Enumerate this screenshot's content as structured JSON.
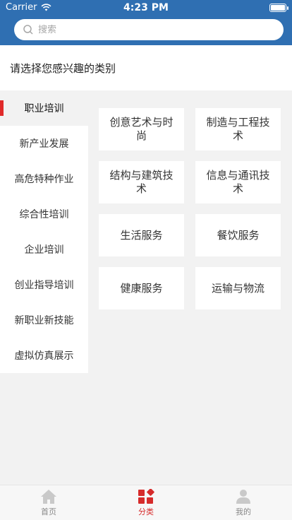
{
  "status_bar": {
    "carrier": "Carrier",
    "time": "4:23 PM"
  },
  "search": {
    "placeholder": "搜索"
  },
  "prompt": "请选择您感兴趣的类别",
  "sidebar": {
    "items": [
      {
        "label": "职业培训",
        "active": true
      },
      {
        "label": "新产业发展"
      },
      {
        "label": "高危特种作业"
      },
      {
        "label": "综合性培训"
      },
      {
        "label": "企业培训"
      },
      {
        "label": "创业指导培训"
      },
      {
        "label": "新职业新技能"
      },
      {
        "label": "虚拟仿真展示"
      }
    ]
  },
  "categories": [
    {
      "label": "创意艺术与时尚"
    },
    {
      "label": "制造与工程技术"
    },
    {
      "label": "结构与建筑技术"
    },
    {
      "label": "信息与通讯技术"
    },
    {
      "label": "生活服务"
    },
    {
      "label": "餐饮服务"
    },
    {
      "label": "健康服务"
    },
    {
      "label": "运输与物流"
    }
  ],
  "tabbar": {
    "tabs": [
      {
        "label": "首页",
        "icon": "home-icon"
      },
      {
        "label": "分类",
        "icon": "category-icon",
        "active": true
      },
      {
        "label": "我的",
        "icon": "user-icon"
      }
    ]
  },
  "colors": {
    "header": "#2f6fb2",
    "accent": "#e02a2a",
    "tab_active": "#d62b2b"
  }
}
